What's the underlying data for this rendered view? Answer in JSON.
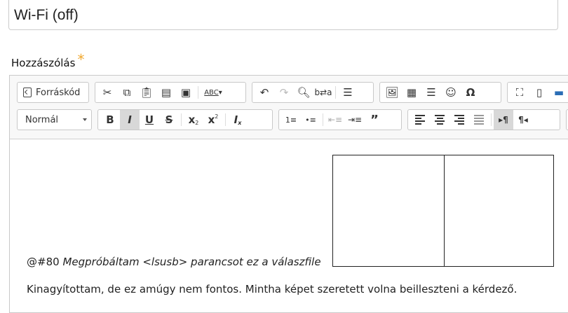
{
  "title_field": {
    "value": "Wi-Fi (off)"
  },
  "comment_label": {
    "text": "Hozzászólás",
    "required_mark": "*"
  },
  "toolbar": {
    "source_label": "Forráskód",
    "format_select": "Normál",
    "icons_row1": [
      "cut-icon",
      "copy-icon",
      "paste-icon",
      "paste-text-icon",
      "paste-word-icon",
      "spellcheck-icon",
      "undo-icon",
      "redo-icon",
      "find-icon",
      "replace-icon",
      "select-all-icon",
      "image-icon",
      "table-icon",
      "horizontal-rule-icon",
      "smiley-icon",
      "special-char-icon",
      "maximize-icon",
      "show-blocks-icon"
    ],
    "icons_row2": [
      "bold-icon",
      "italic-icon",
      "underline-icon",
      "strike-icon",
      "subscript-icon",
      "superscript-icon",
      "remove-format-icon",
      "numbered-list-icon",
      "bulleted-list-icon",
      "outdent-icon",
      "indent-icon",
      "blockquote-icon",
      "align-left-icon",
      "align-center-icon",
      "align-right-icon",
      "justify-icon",
      "ltr-icon",
      "rtl-icon"
    ]
  },
  "content": {
    "para1_prefix": "@#80 ",
    "para1_italic": "Megpróbáltam <lsusb> parancsot ez a válaszfile",
    "para2": "Kinagyítottam, de ez amúgy nem fontos. Mintha képet szeretett volna beilleszteni a kérdező."
  }
}
